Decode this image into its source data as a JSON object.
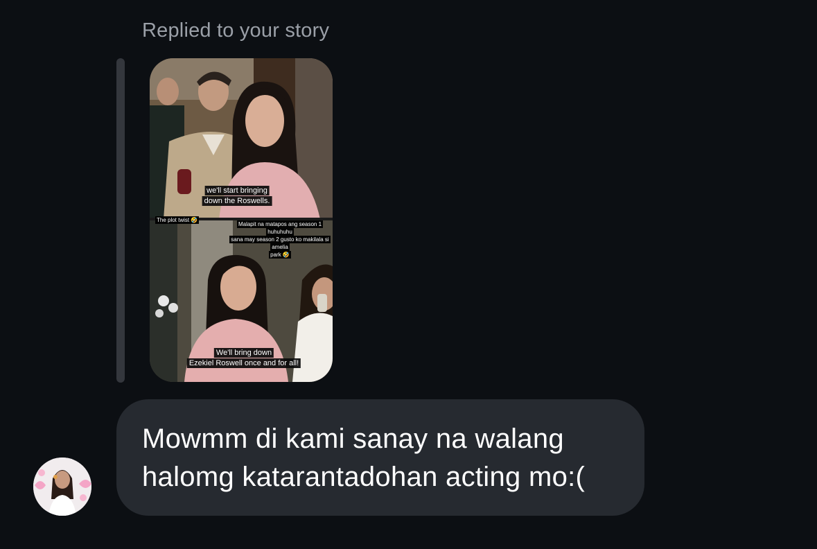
{
  "reply_context": "Replied to your story",
  "story": {
    "top_caption_line1": "we'll start bringing",
    "top_caption_line2": "down the Roswells.",
    "sticker_left": "The plot twist 🤣",
    "sticker_right_line1": "Malapit na matapos ang season 1 huhuhuhu",
    "sticker_right_line2": "sana may season 2 gusto ko makilala si amelia",
    "sticker_right_line3": "park 🤣",
    "bottom_caption_line1": "We'll bring down",
    "bottom_caption_line2": "Ezekiel Roswell once and for all!"
  },
  "message": {
    "text": "Mowmm di kami sanay na walang halomg katarantadohan acting mo:("
  },
  "colors": {
    "background": "#0c0f13",
    "bubble": "#262a30",
    "context_text": "#9ba0a8",
    "quote_bar": "#34373d"
  }
}
